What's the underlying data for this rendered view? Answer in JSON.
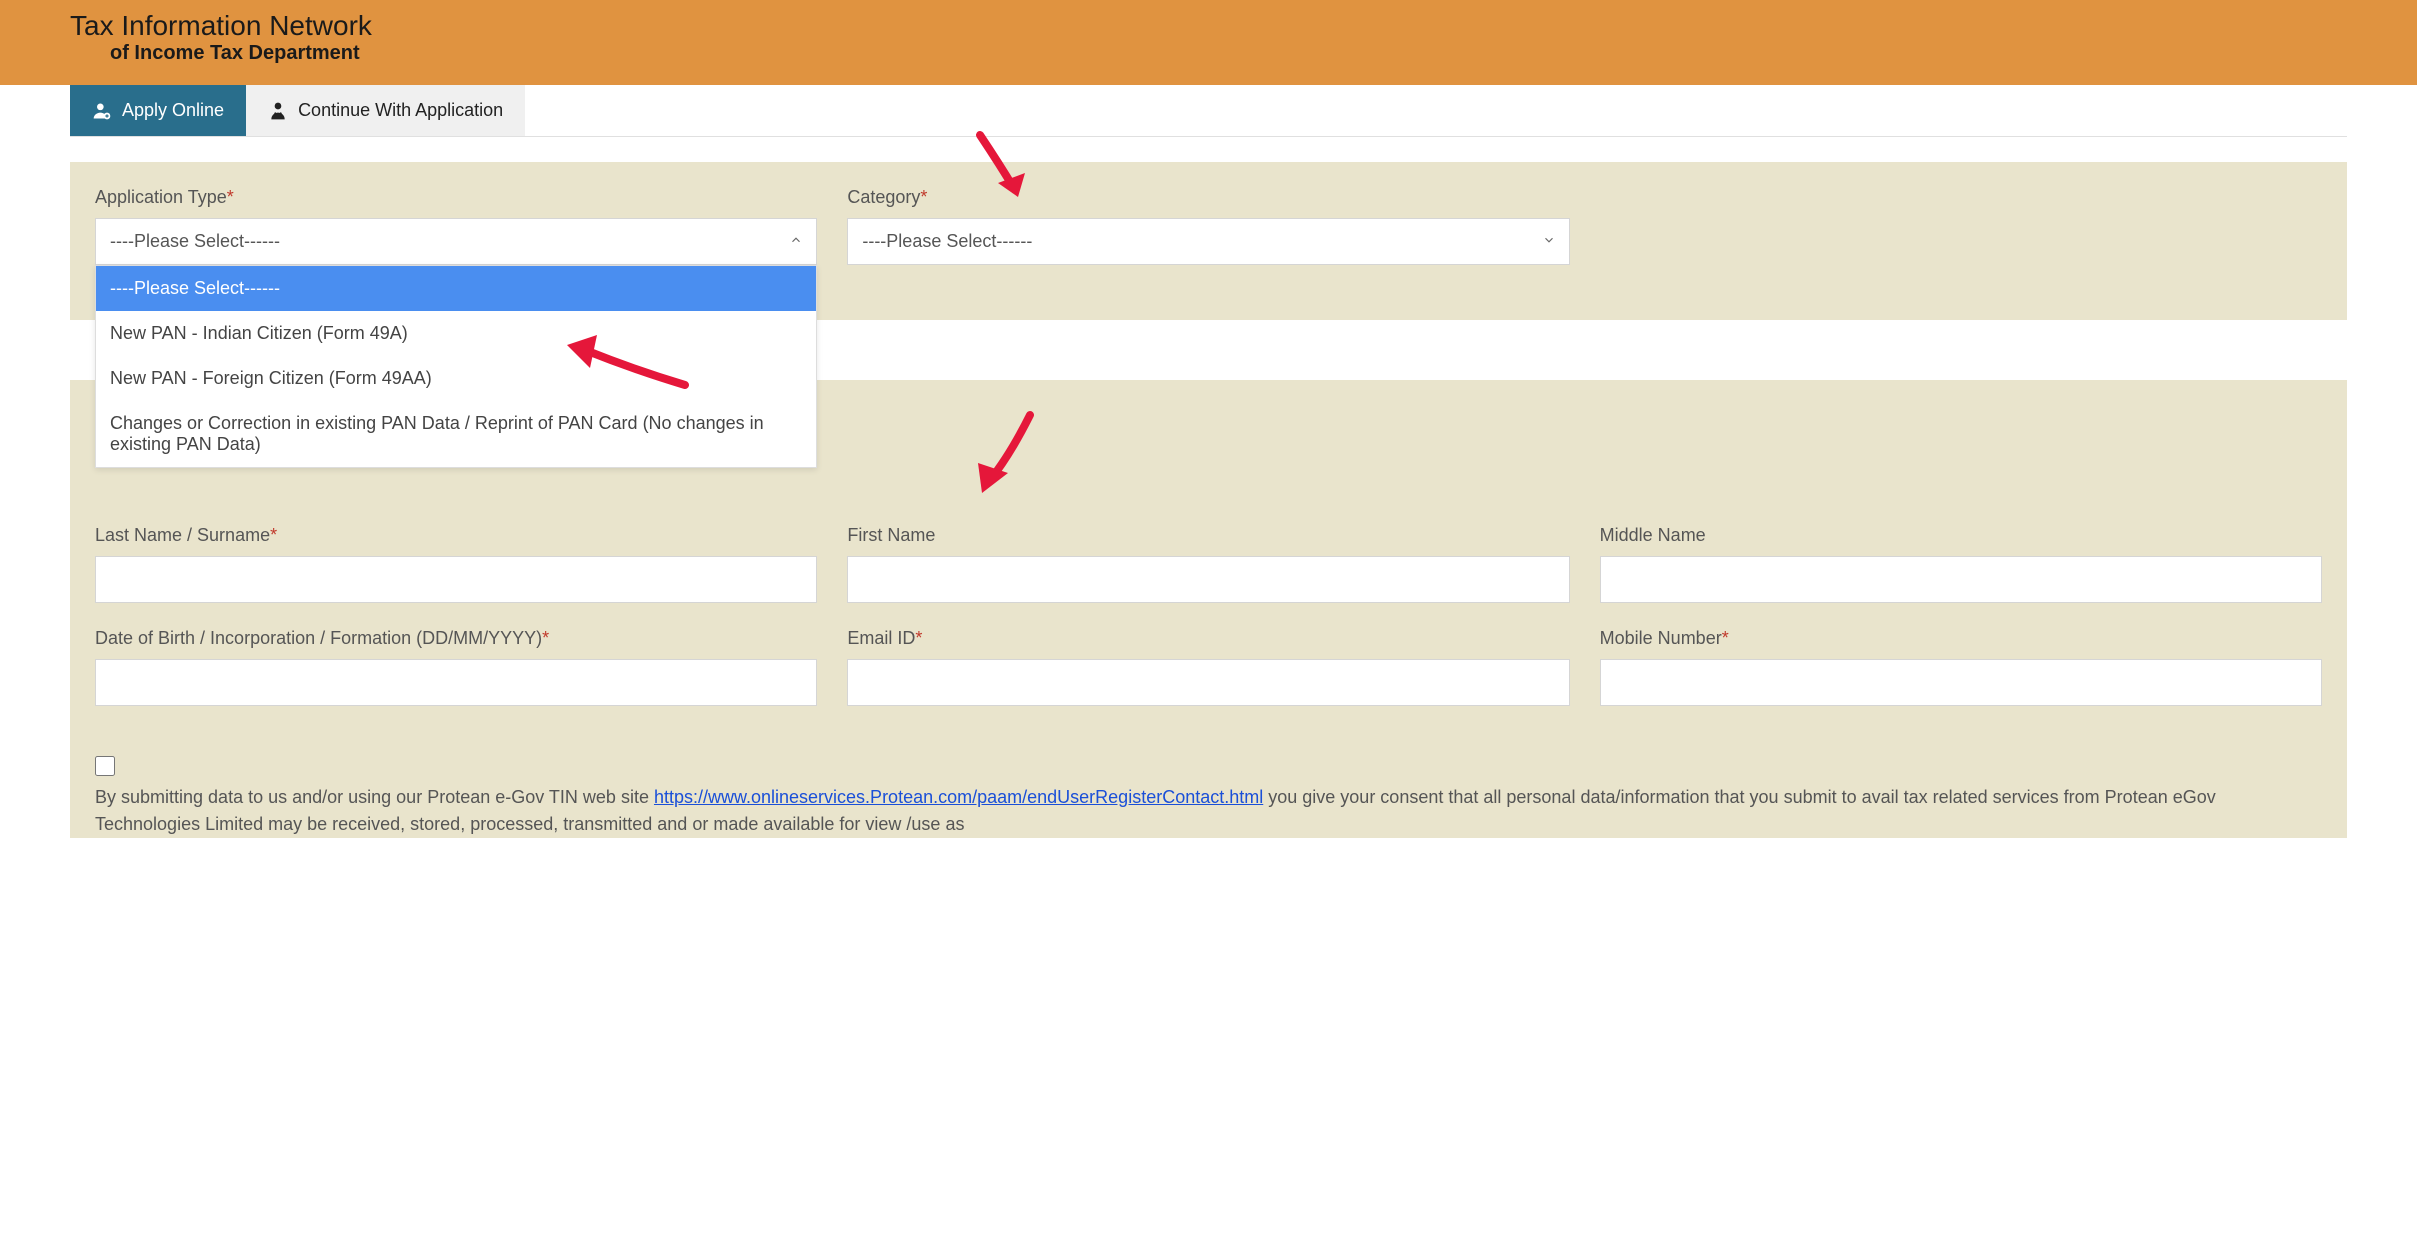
{
  "header": {
    "title": "Tax Information Network",
    "subtitle": "of Income Tax Department"
  },
  "tabs": {
    "apply_online": "Apply Online",
    "continue": "Continue With Application"
  },
  "form": {
    "application_type_label": "Application Type",
    "application_type_value": "----Please Select------",
    "application_type_options": {
      "opt0": "----Please Select------",
      "opt1": "New PAN - Indian Citizen (Form 49A)",
      "opt2": "New PAN - Foreign Citizen (Form 49AA)",
      "opt3": "Changes or Correction in existing PAN Data / Reprint of PAN Card (No changes in existing PAN Data)"
    },
    "category_label": "Category",
    "category_value": "----Please Select------",
    "last_name_label": "Last Name / Surname",
    "first_name_label": "First Name",
    "middle_name_label": "Middle Name",
    "dob_label": "Date of Birth / Incorporation / Formation (DD/MM/YYYY)",
    "email_label": "Email ID",
    "mobile_label": "Mobile Number"
  },
  "consent": {
    "prefix": "By submitting data to us and/or using our Protean e-Gov TIN web site ",
    "link": "https://www.onlineservices.Protean.com/paam/endUserRegisterContact.html",
    "suffix": " you give your consent that all personal data/information that you submit to avail tax related services from Protean eGov Technologies Limited may be received, stored, processed, transmitted and or made available for view /use as"
  }
}
